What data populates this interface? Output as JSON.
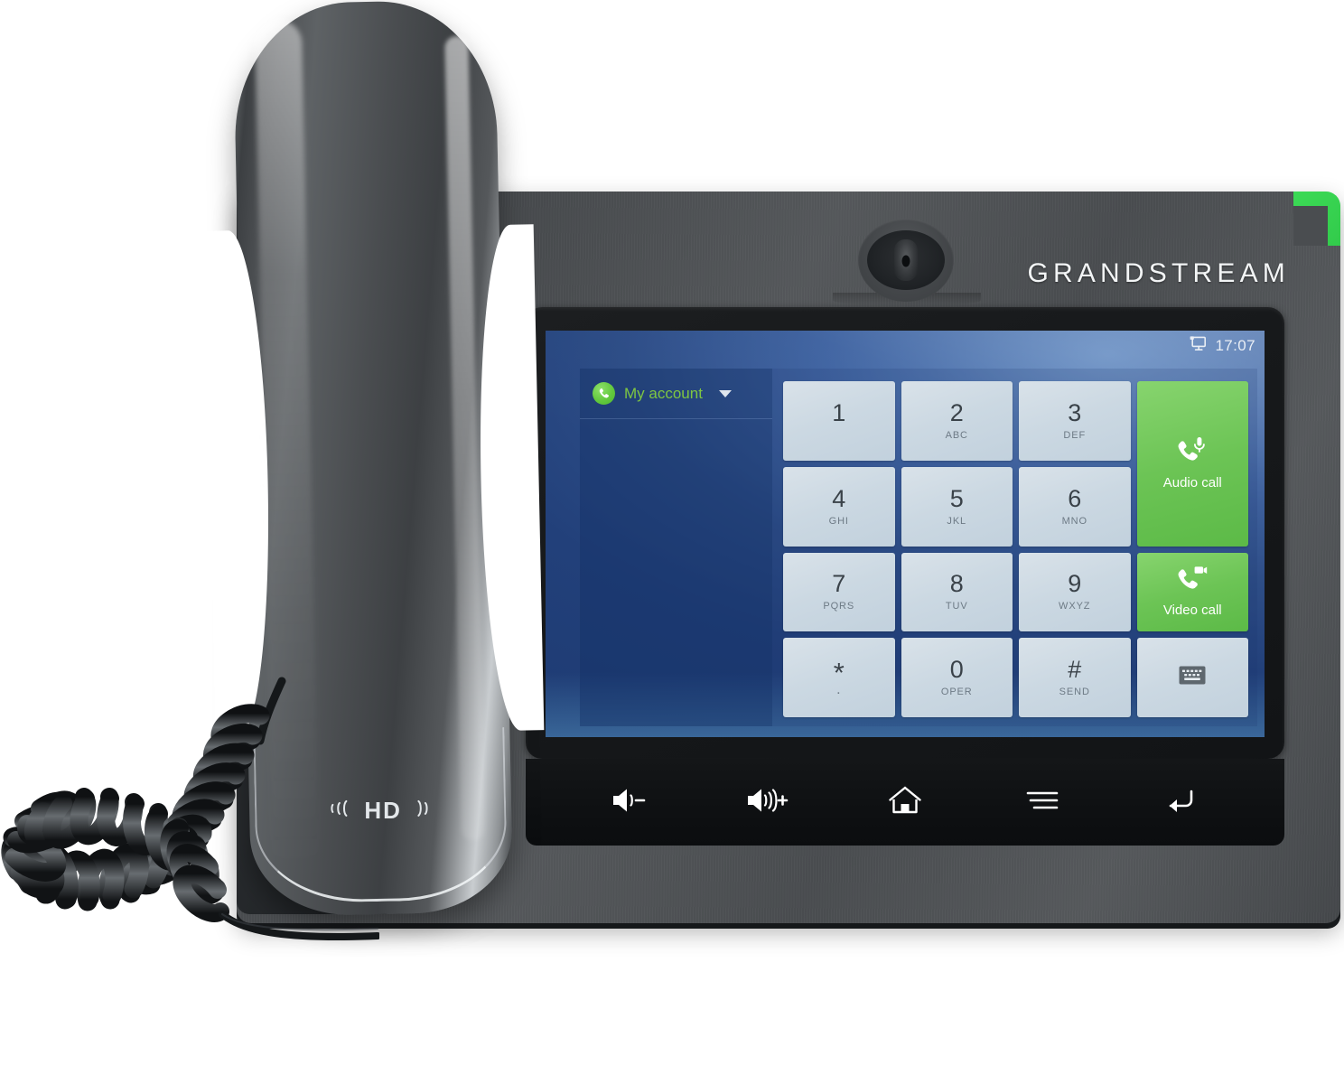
{
  "device": {
    "brand": "GRANDSTREAM",
    "handset_badge": "HD",
    "handset_badge_left_icon": "signal-waves-left-icon",
    "handset_badge_right_icon": "signal-waves-right-icon",
    "camera_icon": "front-camera-icon",
    "accent_color": "#3ddc57",
    "body_color": "#4a4d50"
  },
  "screen": {
    "status_bar": {
      "display_icon": "monitor-icon",
      "time": "17:07"
    },
    "account": {
      "icon": "phone-handset-icon",
      "label": "My account",
      "caret_icon": "chevron-down-icon"
    },
    "keypad": {
      "keys": [
        {
          "digit": "1",
          "sub": ""
        },
        {
          "digit": "2",
          "sub": "ABC"
        },
        {
          "digit": "3",
          "sub": "DEF"
        },
        {
          "digit": "4",
          "sub": "GHI"
        },
        {
          "digit": "5",
          "sub": "JKL"
        },
        {
          "digit": "6",
          "sub": "MNO"
        },
        {
          "digit": "7",
          "sub": "PQRS"
        },
        {
          "digit": "8",
          "sub": "TUV"
        },
        {
          "digit": "9",
          "sub": "WXYZ"
        },
        {
          "digit": "*",
          "sub": "."
        },
        {
          "digit": "0",
          "sub": "OPER"
        },
        {
          "digit": "#",
          "sub": "SEND"
        }
      ],
      "actions": [
        {
          "label": "Audio call",
          "icon": "phone-microphone-icon",
          "color": "#6cc455"
        },
        {
          "label": "Video call",
          "icon": "phone-video-icon",
          "color": "#6cc455"
        }
      ],
      "keyboard_key_icon": "keyboard-icon"
    },
    "colors": {
      "background_top": "#2c4c86",
      "background_bottom": "#5fb3df",
      "key_face": "#cbd8e2",
      "key_text": "#3a4249",
      "account_text": "#7ec642"
    }
  },
  "navbar": {
    "buttons": [
      {
        "name": "volume-down",
        "icon": "volume-down-icon"
      },
      {
        "name": "volume-up",
        "icon": "volume-up-icon"
      },
      {
        "name": "home",
        "icon": "home-icon"
      },
      {
        "name": "menu",
        "icon": "menu-icon"
      },
      {
        "name": "back",
        "icon": "back-arrow-icon"
      }
    ]
  }
}
